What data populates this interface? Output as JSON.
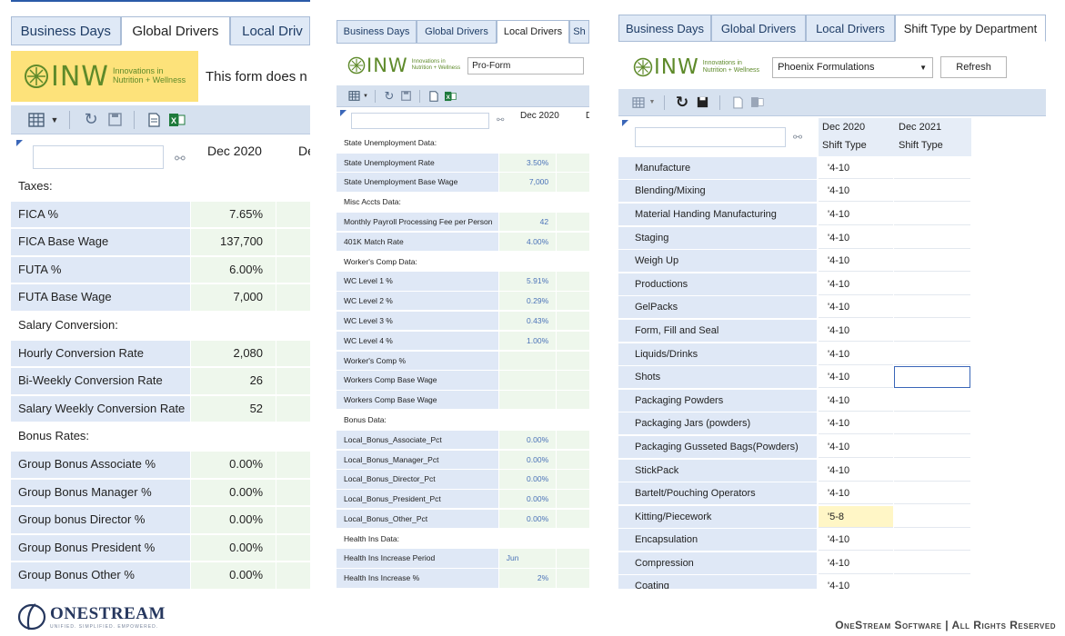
{
  "panel1": {
    "tabs": [
      "Business Days",
      "Global Drivers",
      "Local Driv"
    ],
    "active_tab": 1,
    "logo_main": "INW",
    "logo_sub1": "Innovations in",
    "logo_sub2": "Nutrition + Wellness",
    "notice": "This form does n",
    "column": "Dec 2020",
    "column_partial": "De",
    "rows": [
      {
        "label": "Taxes:",
        "value": "",
        "section": true
      },
      {
        "label": "FICA %",
        "value": "7.65%"
      },
      {
        "label": "FICA Base Wage",
        "value": "137,700"
      },
      {
        "label": "FUTA %",
        "value": "6.00%"
      },
      {
        "label": "FUTA Base Wage",
        "value": "7,000"
      },
      {
        "label": "Salary Conversion:",
        "value": "",
        "section": true
      },
      {
        "label": "Hourly Conversion Rate",
        "value": "2,080"
      },
      {
        "label": "Bi-Weekly Conversion Rate",
        "value": "26"
      },
      {
        "label": "Salary Weekly Conversion Rate",
        "value": "52"
      },
      {
        "label": "Bonus Rates:",
        "value": "",
        "section": true
      },
      {
        "label": "Group Bonus Associate %",
        "value": "0.00%"
      },
      {
        "label": "Group Bonus Manager %",
        "value": "0.00%"
      },
      {
        "label": "Group bonus Director %",
        "value": "0.00%"
      },
      {
        "label": "Group Bonus President %",
        "value": "0.00%"
      },
      {
        "label": "Group Bonus Other %",
        "value": "0.00%"
      }
    ]
  },
  "panel2": {
    "tabs": [
      "Business Days",
      "Global Drivers",
      "Local Drivers",
      "Sh"
    ],
    "active_tab": 2,
    "logo_main": "INW",
    "logo_sub1": "Innovations in",
    "logo_sub2": "Nutrition + Wellness",
    "entity": "Pro-Form",
    "column": "Dec 2020",
    "column_partial": "D",
    "rows": [
      {
        "label": "State Unemployment Data:",
        "value": "",
        "section": true
      },
      {
        "label": "State Unemployment Rate",
        "value": "3.50%"
      },
      {
        "label": "State Unemployment Base Wage",
        "value": "7,000"
      },
      {
        "label": "Misc Accts Data:",
        "value": "",
        "section": true
      },
      {
        "label": "Monthly Payroll Processing Fee per Person",
        "value": "42"
      },
      {
        "label": "401K Match Rate",
        "value": "4.00%"
      },
      {
        "label": "Worker's Comp Data:",
        "value": "",
        "section": true
      },
      {
        "label": "WC Level 1 %",
        "value": "5.91%"
      },
      {
        "label": "WC Level 2 %",
        "value": "0.29%"
      },
      {
        "label": "WC Level 3 %",
        "value": "0.43%"
      },
      {
        "label": "WC Level 4 %",
        "value": "1.00%"
      },
      {
        "label": "Worker's Comp %",
        "value": ""
      },
      {
        "label": "Workers Comp Base Wage",
        "value": ""
      },
      {
        "label": "Workers Comp Base Wage",
        "value": ""
      },
      {
        "label": "Bonus Data:",
        "value": "",
        "section": true
      },
      {
        "label": "Local_Bonus_Associate_Pct",
        "value": "0.00%"
      },
      {
        "label": "Local_Bonus_Manager_Pct",
        "value": "0.00%"
      },
      {
        "label": "Local_Bonus_Director_Pct",
        "value": "0.00%"
      },
      {
        "label": "Local_Bonus_President_Pct",
        "value": "0.00%"
      },
      {
        "label": "Local_Bonus_Other_Pct",
        "value": "0.00%"
      },
      {
        "label": "Health Ins Data:",
        "value": "",
        "section": true
      },
      {
        "label": "Health Ins Increase Period",
        "value": "Jun",
        "left": true
      },
      {
        "label": "Health Ins Increase %",
        "value": "2%"
      }
    ]
  },
  "panel3": {
    "tabs": [
      "Business Days",
      "Global Drivers",
      "Local Drivers",
      "Shift Type by Department"
    ],
    "active_tab": 3,
    "logo_main": "INW",
    "logo_sub1": "Innovations in",
    "logo_sub2": "Nutrition + Wellness",
    "entity": "Phoenix Formulations",
    "refresh_label": "Refresh",
    "columns": [
      "Dec 2020",
      "Dec 2021"
    ],
    "subcolumns": [
      "Shift Type",
      "Shift Type"
    ],
    "rows": [
      {
        "label": "Manufacture",
        "v1": "'4-10"
      },
      {
        "label": "Blending/Mixing",
        "v1": "'4-10"
      },
      {
        "label": "Material Handing Manufacturing",
        "v1": "'4-10"
      },
      {
        "label": "Staging",
        "v1": "'4-10"
      },
      {
        "label": "Weigh Up",
        "v1": "'4-10"
      },
      {
        "label": "Productions",
        "v1": "'4-10"
      },
      {
        "label": "GelPacks",
        "v1": "'4-10"
      },
      {
        "label": "Form, Fill and Seal",
        "v1": "'4-10"
      },
      {
        "label": "Liquids/Drinks",
        "v1": "'4-10"
      },
      {
        "label": "Shots",
        "v1": "'4-10",
        "selected2": true
      },
      {
        "label": "Packaging Powders",
        "v1": "'4-10"
      },
      {
        "label": "Packaging Jars (powders)",
        "v1": "'4-10"
      },
      {
        "label": "Packaging Gusseted Bags(Powders)",
        "v1": "'4-10"
      },
      {
        "label": "StickPack",
        "v1": "'4-10"
      },
      {
        "label": "Bartelt/Pouching Operators",
        "v1": "'4-10"
      },
      {
        "label": "Kitting/Piecework",
        "v1": "'5-8",
        "highlight": true
      },
      {
        "label": "Encapsulation",
        "v1": "'4-10"
      },
      {
        "label": "Compression",
        "v1": "'4-10"
      },
      {
        "label": "Coating",
        "v1": "'4-10"
      }
    ]
  },
  "footer": {
    "brand": "ONESTREAM",
    "tagline": "UNIFIED. SIMPLIFIED. EMPOWERED.",
    "copyright": "OneStream Software | All Rights Reserved"
  },
  "colors": {
    "label_bg": "#dfe8f6",
    "value_bg": "#eef7ec",
    "toolbar_bg": "#d6e1ef",
    "logo_green": "#5e8a2a",
    "notice_bg": "#fde27a",
    "kitting_highlight": "#fff6c6"
  }
}
